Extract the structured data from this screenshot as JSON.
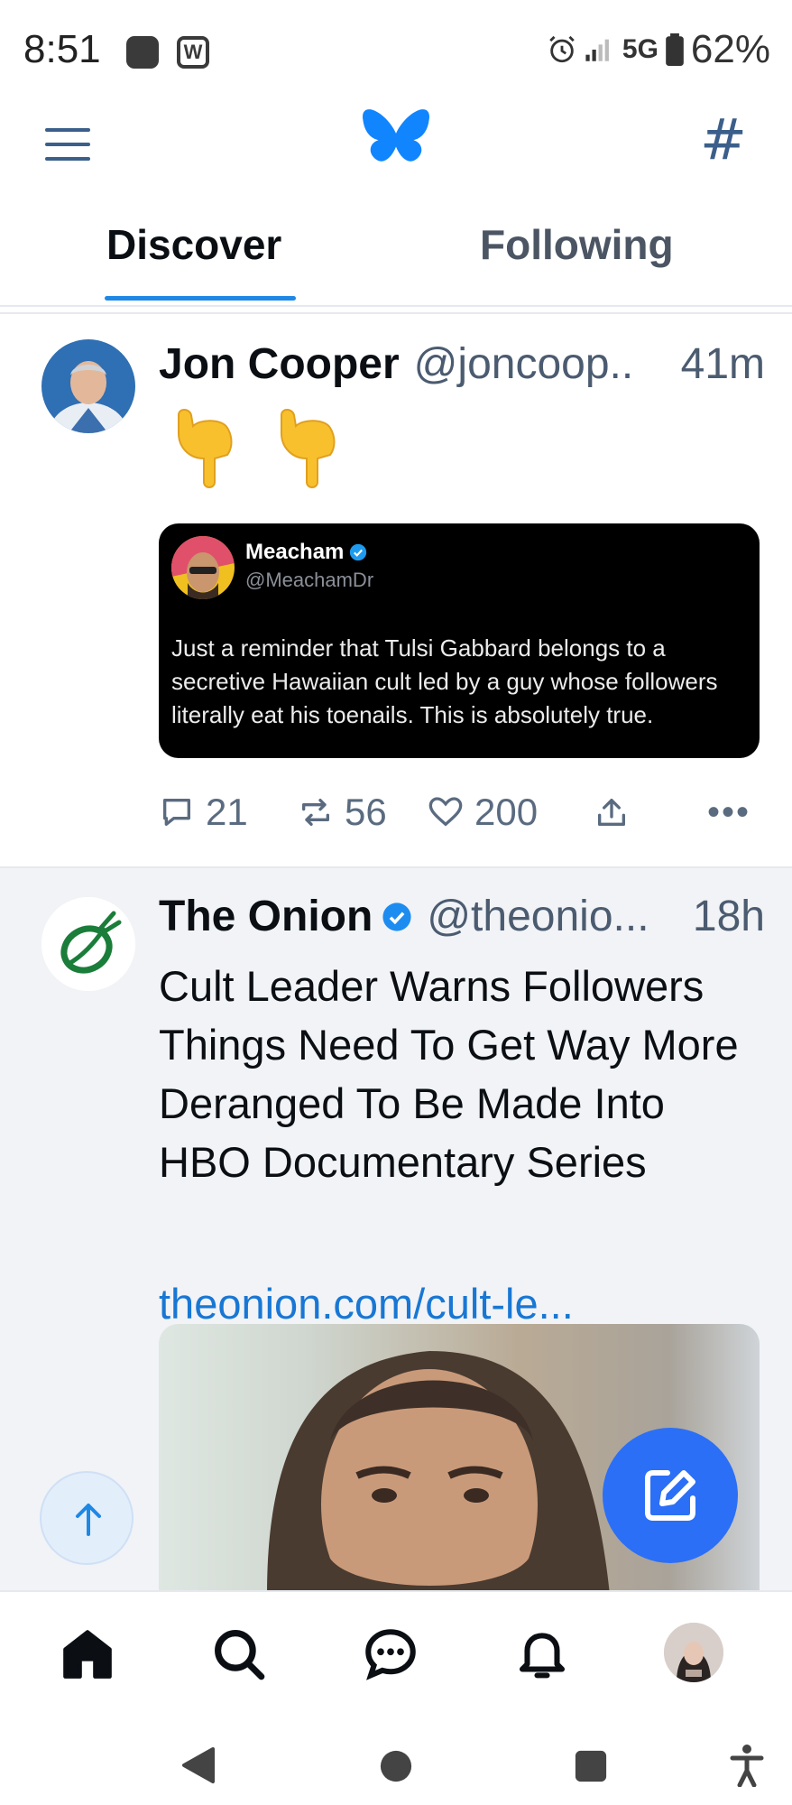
{
  "status_bar": {
    "time": "8:51",
    "network": "5G",
    "battery": "62%",
    "icons": [
      "app-notification-icon",
      "w-app-icon",
      "alarm-icon",
      "signal-icon",
      "battery-icon"
    ]
  },
  "header": {
    "menu_icon": "hamburger-menu-icon",
    "logo": "butterfly-logo",
    "feeds_icon": "hashtag-icon"
  },
  "tabs": [
    {
      "label": "Discover",
      "active": true
    },
    {
      "label": "Following",
      "active": false
    }
  ],
  "posts": [
    {
      "author": "Jon Cooper",
      "handle": "@joncoop..",
      "time": "41m",
      "text": "👇 👇",
      "embed": {
        "author": "Meacham",
        "handle": "@MeachamDr",
        "verified": true,
        "text": "Just a reminder that Tulsi Gabbard belongs to a secretive Hawaiian cult led by a guy whose followers literally eat his toenails. This is absolutely true."
      },
      "replies": "21",
      "reposts": "56",
      "likes": "200"
    },
    {
      "author": "The Onion",
      "handle": "@theonio...",
      "time": "18h",
      "verified": true,
      "text": "Cult Leader Warns Followers Things Need To Get Way More Deranged To Be Made Into HBO Documentary Series",
      "link": "theonion.com/cult-le..."
    }
  ],
  "colors": {
    "accent": "#1e88e5",
    "compose_button": "#2b6ff6",
    "link": "#1877d4",
    "verified": "#1d8cf0"
  },
  "bottom_nav": [
    "home-icon",
    "search-icon",
    "chat-icon",
    "notifications-icon",
    "profile-avatar"
  ],
  "system_nav": [
    "back-icon",
    "home-circle-icon",
    "recents-icon",
    "accessibility-icon"
  ]
}
